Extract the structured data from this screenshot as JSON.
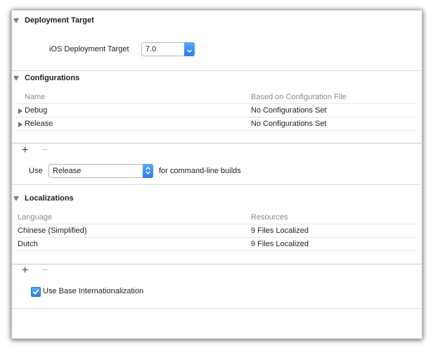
{
  "deployment": {
    "title": "Deployment Target",
    "field_label": "iOS Deployment Target",
    "value": "7.0"
  },
  "configurations": {
    "title": "Configurations",
    "columns": [
      "Name",
      "Based on Configuration File"
    ],
    "rows": [
      {
        "name": "Debug",
        "based_on": "No Configurations Set"
      },
      {
        "name": "Release",
        "based_on": "No Configurations Set"
      }
    ],
    "use_label": "Use",
    "use_value": "Release",
    "use_suffix": "for command-line builds",
    "add_label": "+",
    "remove_label": "−"
  },
  "localizations": {
    "title": "Localizations",
    "columns": [
      "Language",
      "Resources"
    ],
    "rows": [
      {
        "language": "Chinese (Simplified)",
        "resources": "9 Files Localized"
      },
      {
        "language": "Dutch",
        "resources": "9 Files Localized"
      }
    ],
    "add_label": "+",
    "remove_label": "−",
    "base_intl_label": "Use Base Internationalization",
    "base_intl_checked": true
  },
  "icons": {
    "section_disclosure": "disclosure-triangle-down-icon",
    "row_disclosure": "disclosure-triangle-right-icon",
    "popup_arrows": "chevron-updown-icon",
    "checkmark": "checkmark-icon"
  },
  "colors": {
    "accent": "#2a7ef0"
  }
}
